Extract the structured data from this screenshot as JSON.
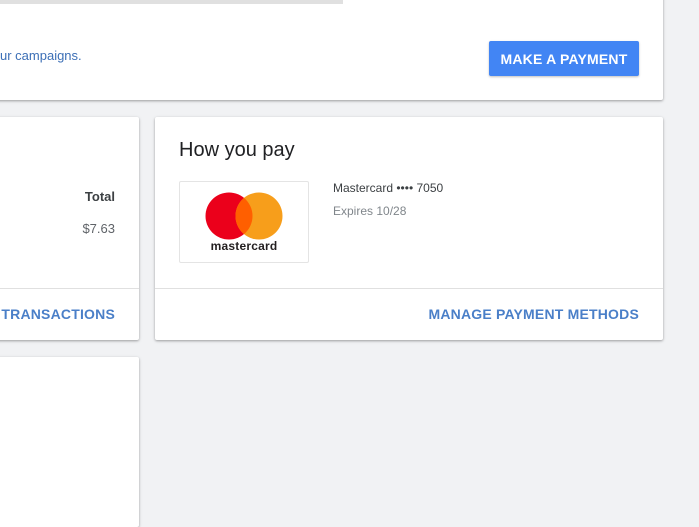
{
  "billing_summary": {
    "campaign_text": "ur campaigns.",
    "make_payment_label": "MAKE A PAYMENT"
  },
  "transactions": {
    "total_header": "Total",
    "total_value": "$7.63",
    "view_transactions_label": "W TRANSACTIONS"
  },
  "how_you_pay": {
    "title": "How you pay",
    "card_brand_wordmark": "mastercard",
    "card_name": "Mastercard •••• 7050",
    "card_expiry": "Expires 10/28",
    "manage_label": "MANAGE PAYMENT METHODS",
    "logo_colors": {
      "red": "#eb001b",
      "orange": "#f79e1b",
      "overlap": "#ff5f00"
    }
  },
  "colors": {
    "primary_button": "#4285f4",
    "link": "#4a7fc8",
    "background": "#f1f2f4"
  },
  "icons": {
    "card_logo": "mastercard-logo-icon"
  }
}
